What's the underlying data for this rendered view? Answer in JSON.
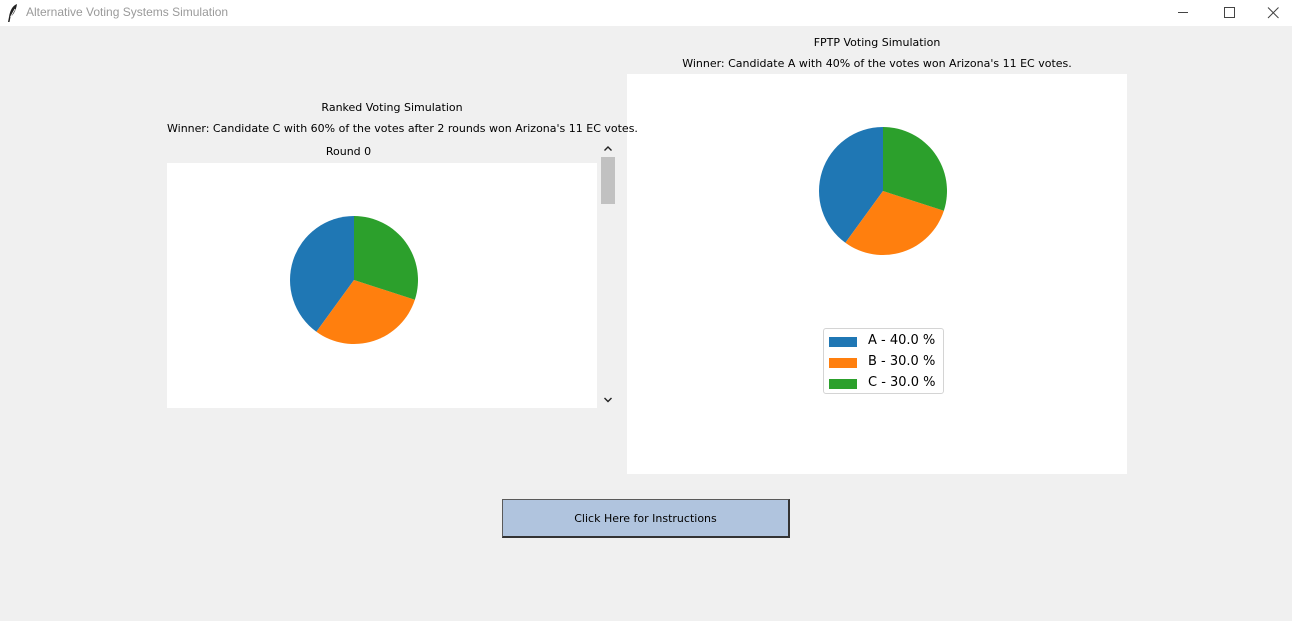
{
  "window": {
    "title": "Alternative Voting Systems Simulation",
    "icons": [
      "feather-icon",
      "minimize-icon",
      "maximize-icon",
      "close-icon"
    ]
  },
  "ranked": {
    "heading": "Ranked Voting Simulation",
    "winner_text": "Winner: Candidate C with 60% of the votes after 2 rounds won Arizona's 11 EC votes.",
    "round_label": "Round 0"
  },
  "fptp": {
    "heading": "FPTP Voting Simulation",
    "winner_text": "Winner: Candidate A with 40% of the votes won Arizona's 11 EC votes."
  },
  "instructions_button": {
    "label": "Click Here for Instructions"
  },
  "colors": {
    "A": "#1f77b4",
    "B": "#ff7f0e",
    "C": "#2ca02c",
    "button_bg": "#b0c4de"
  },
  "chart_data": [
    {
      "type": "pie",
      "name_ref": "ranked-round-0",
      "categories": [
        "A",
        "B",
        "C"
      ],
      "values": [
        40,
        30,
        30
      ],
      "colors": [
        "#1f77b4",
        "#ff7f0e",
        "#2ca02c"
      ],
      "start_angle_deg": 90,
      "direction": "clockwise-from-top: C, B, A",
      "title": "",
      "legend": null
    },
    {
      "type": "pie",
      "name_ref": "fptp",
      "categories": [
        "A",
        "B",
        "C"
      ],
      "values": [
        40,
        30,
        30
      ],
      "colors": [
        "#1f77b4",
        "#ff7f0e",
        "#2ca02c"
      ],
      "start_angle_deg": 90,
      "title": "",
      "legend": {
        "placement": "lower-center",
        "entries": [
          "A - 40.0 %",
          "B - 30.0 %",
          "C - 30.0 %"
        ]
      }
    }
  ]
}
